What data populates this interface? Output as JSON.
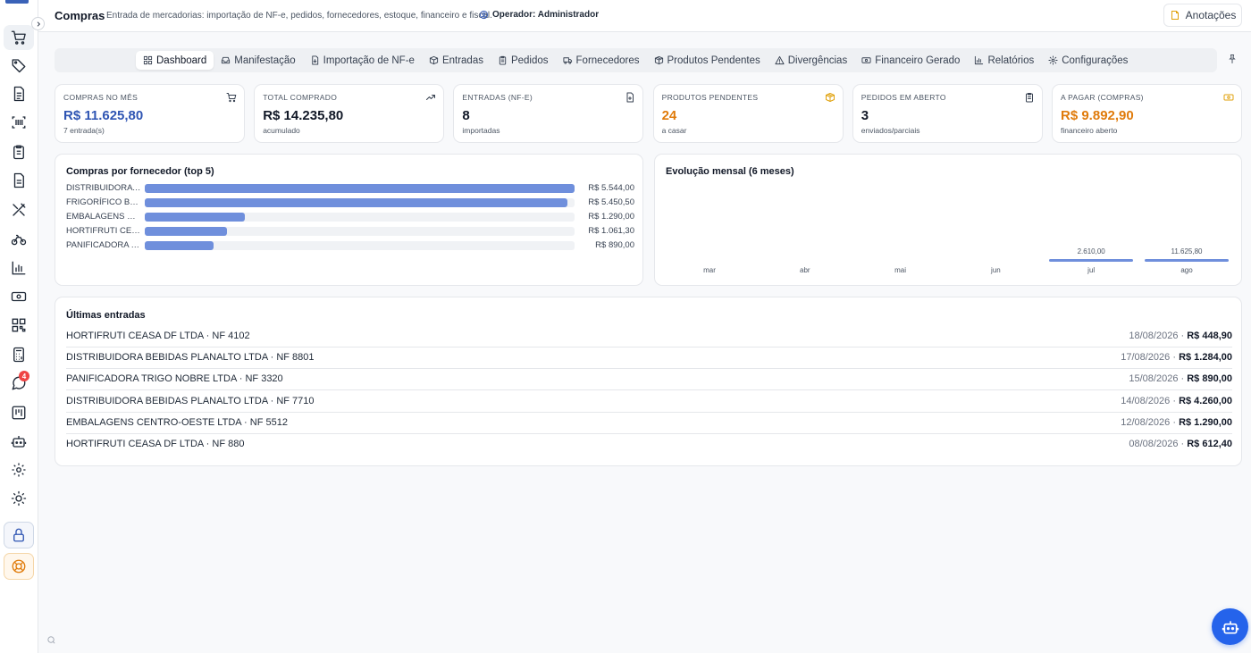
{
  "header": {
    "title": "Compras",
    "subtitle": "Entrada de mercadorias: importação de NF-e, pedidos, fornecedores, estoque, financeiro e fiscal.",
    "operator": "Operador: Administrador",
    "notes_label": "Anotações"
  },
  "sidebar": {
    "items": [
      "cart-icon",
      "tag-icon",
      "document-icon",
      "barcode-icon",
      "clipboard-icon",
      "file-text-icon",
      "tools-icon",
      "bike-icon",
      "bar-chart-icon",
      "money-icon",
      "qr-code-icon",
      "calculator-icon",
      "chat-icon",
      "board-icon",
      "robot-icon",
      "gear-icon",
      "sun-icon",
      "lock-icon",
      "lifebuoy-icon"
    ],
    "chat_badge": "4"
  },
  "tabs": [
    {
      "label": "Dashboard",
      "icon": "grid-icon",
      "active": true
    },
    {
      "label": "Manifestação",
      "icon": "inbox-icon",
      "active": false
    },
    {
      "label": "Importação de NF-e",
      "icon": "file-import-icon",
      "active": false
    },
    {
      "label": "Entradas",
      "icon": "box-icon",
      "active": false
    },
    {
      "label": "Pedidos",
      "icon": "clipboard-icon",
      "active": false
    },
    {
      "label": "Fornecedores",
      "icon": "truck-icon",
      "active": false
    },
    {
      "label": "Produtos Pendentes",
      "icon": "package-icon",
      "active": false
    },
    {
      "label": "Divergências",
      "icon": "warning-icon",
      "active": false
    },
    {
      "label": "Financeiro Gerado",
      "icon": "money-icon",
      "active": false
    },
    {
      "label": "Relatórios",
      "icon": "bar-chart-icon",
      "active": false
    },
    {
      "label": "Configurações",
      "icon": "gear-icon",
      "active": false
    }
  ],
  "kpis": [
    {
      "label": "COMPRAS NO MÊS",
      "value": "R$ 11.625,80",
      "sub": "7 entrada(s)",
      "color": "#2f55b3",
      "icon": "cart-icon"
    },
    {
      "label": "TOTAL COMPRADO",
      "value": "R$ 14.235,80",
      "sub": "acumulado",
      "color": "#111827",
      "icon": "trend-up-icon"
    },
    {
      "label": "ENTRADAS (NF-E)",
      "value": "8",
      "sub": "importadas",
      "color": "#111827",
      "icon": "file-plus-icon"
    },
    {
      "label": "PRODUTOS PENDENTES",
      "value": "24",
      "sub": "a casar",
      "color": "#e07b0b",
      "icon": "package-icon"
    },
    {
      "label": "PEDIDOS EM ABERTO",
      "value": "3",
      "sub": "enviados/parciais",
      "color": "#111827",
      "icon": "clipboard-icon"
    },
    {
      "label": "A PAGAR (COMPRAS)",
      "value": "R$ 9.892,90",
      "sub": "financeiro aberto",
      "color": "#e07b0b",
      "icon": "money-icon"
    }
  ],
  "suppliers_chart": {
    "title": "Compras por fornecedor (top 5)",
    "rows": [
      {
        "name": "DISTRIBUIDORA ...",
        "value": 5544.0,
        "label": "R$ 5.544,00"
      },
      {
        "name": "FRIGORÍFICO BOI...",
        "value": 5450.5,
        "label": "R$ 5.450,50"
      },
      {
        "name": "EMBALAGENS CE...",
        "value": 1290.0,
        "label": "R$ 1.290,00"
      },
      {
        "name": "HORTIFRUTI CEA...",
        "value": 1061.3,
        "label": "R$ 1.061,30"
      },
      {
        "name": "PANIFICADORA T...",
        "value": 890.0,
        "label": "R$ 890,00"
      }
    ]
  },
  "monthly_chart": {
    "title": "Evolução mensal (6 meses)",
    "months": [
      {
        "month": "mar",
        "value": 0,
        "label": ""
      },
      {
        "month": "abr",
        "value": 0,
        "label": ""
      },
      {
        "month": "mai",
        "value": 0,
        "label": ""
      },
      {
        "month": "jun",
        "value": 0,
        "label": ""
      },
      {
        "month": "jul",
        "value": 2610.0,
        "label": "2.610,00"
      },
      {
        "month": "ago",
        "value": 11625.8,
        "label": "11.625,80"
      }
    ]
  },
  "chart_data": [
    {
      "type": "bar",
      "title": "Compras por fornecedor (top 5)",
      "categories": [
        "DISTRIBUIDORA ...",
        "FRIGORÍFICO BOI...",
        "EMBALAGENS CE...",
        "HORTIFRUTI CEA...",
        "PANIFICADORA T..."
      ],
      "values": [
        5544.0,
        5450.5,
        1290.0,
        1061.3,
        890.0
      ],
      "orientation": "horizontal"
    },
    {
      "type": "bar",
      "title": "Evolução mensal (6 meses)",
      "categories": [
        "mar",
        "abr",
        "mai",
        "jun",
        "jul",
        "ago"
      ],
      "values": [
        0,
        0,
        0,
        0,
        2610.0,
        11625.8
      ]
    }
  ],
  "entries": {
    "title": "Últimas entradas",
    "rows": [
      {
        "name": "HORTIFRUTI CEASA DF LTDA · NF 4102",
        "date": "18/08/2026 · ",
        "amount": "R$ 448,90"
      },
      {
        "name": "DISTRIBUIDORA BEBIDAS PLANALTO LTDA · NF 8801",
        "date": "17/08/2026 · ",
        "amount": "R$ 1.284,00"
      },
      {
        "name": "PANIFICADORA TRIGO NOBRE LTDA · NF 3320",
        "date": "15/08/2026 · ",
        "amount": "R$ 890,00"
      },
      {
        "name": "DISTRIBUIDORA BEBIDAS PLANALTO LTDA · NF 7710",
        "date": "14/08/2026 · ",
        "amount": "R$ 4.260,00"
      },
      {
        "name": "EMBALAGENS CENTRO-OESTE LTDA · NF 5512",
        "date": "12/08/2026 · ",
        "amount": "R$ 1.290,00"
      },
      {
        "name": "HORTIFRUTI CEASA DF LTDA · NF 880",
        "date": "08/08/2026 · ",
        "amount": "R$ 612,40"
      }
    ]
  }
}
